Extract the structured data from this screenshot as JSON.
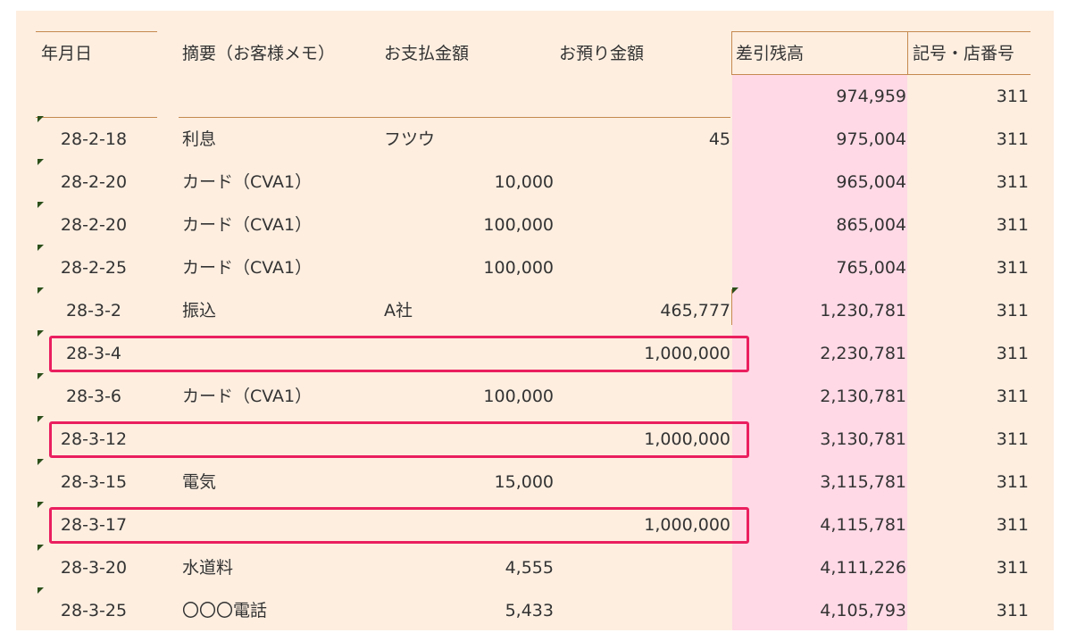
{
  "header": {
    "date": "年月日",
    "description": "摘要（お客様メモ）",
    "payment": "お支払金額",
    "deposit": "お預り金額",
    "balance": "差引残高",
    "code": "記号・店番号"
  },
  "opening": {
    "balance": "974,959",
    "code": "311"
  },
  "rows": [
    {
      "date": "28-2-18",
      "desc": "利息",
      "memo": "フツウ",
      "payment": "",
      "deposit": "45",
      "balance": "975,004",
      "code": "311",
      "highlighted": false
    },
    {
      "date": "28-2-20",
      "desc": "カード（CVA1）",
      "memo": "",
      "payment": "10,000",
      "deposit": "",
      "balance": "965,004",
      "code": "311",
      "highlighted": false
    },
    {
      "date": "28-2-20",
      "desc": "カード（CVA1）",
      "memo": "",
      "payment": "100,000",
      "deposit": "",
      "balance": "865,004",
      "code": "311",
      "highlighted": false
    },
    {
      "date": "28-2-25",
      "desc": "カード（CVA1）",
      "memo": "",
      "payment": "100,000",
      "deposit": "",
      "balance": "765,004",
      "code": "311",
      "highlighted": false
    },
    {
      "date": "28-3-2",
      "desc": "振込",
      "memo": "A社",
      "payment": "",
      "deposit": "465,777",
      "balance": "1,230,781",
      "code": "311",
      "highlighted": false
    },
    {
      "date": "28-3-4",
      "desc": "",
      "memo": "",
      "payment": "",
      "deposit": "1,000,000",
      "balance": "2,230,781",
      "code": "311",
      "highlighted": true
    },
    {
      "date": "28-3-6",
      "desc": "カード（CVA1）",
      "memo": "",
      "payment": "100,000",
      "deposit": "",
      "balance": "2,130,781",
      "code": "311",
      "highlighted": false
    },
    {
      "date": "28-3-12",
      "desc": "",
      "memo": "",
      "payment": "",
      "deposit": "1,000,000",
      "balance": "3,130,781",
      "code": "311",
      "highlighted": true
    },
    {
      "date": "28-3-15",
      "desc": "電気",
      "memo": "",
      "payment": "15,000",
      "deposit": "",
      "balance": "3,115,781",
      "code": "311",
      "highlighted": false
    },
    {
      "date": "28-3-17",
      "desc": "",
      "memo": "",
      "payment": "",
      "deposit": "1,000,000",
      "balance": "4,115,781",
      "code": "311",
      "highlighted": true
    },
    {
      "date": "28-3-20",
      "desc": "水道料",
      "memo": "",
      "payment": "4,555",
      "deposit": "",
      "balance": "4,111,226",
      "code": "311",
      "highlighted": false
    },
    {
      "date": "28-3-25",
      "desc": "〇〇〇電話",
      "memo": "",
      "payment": "5,433",
      "deposit": "",
      "balance": "4,105,793",
      "code": "311",
      "highlighted": false
    }
  ],
  "colors": {
    "background": "#fdeee0",
    "balance_column": "#ffd9e6",
    "rule": "#c5894f",
    "highlight": "#ea1f5f",
    "marker": "#2c4f1a"
  }
}
